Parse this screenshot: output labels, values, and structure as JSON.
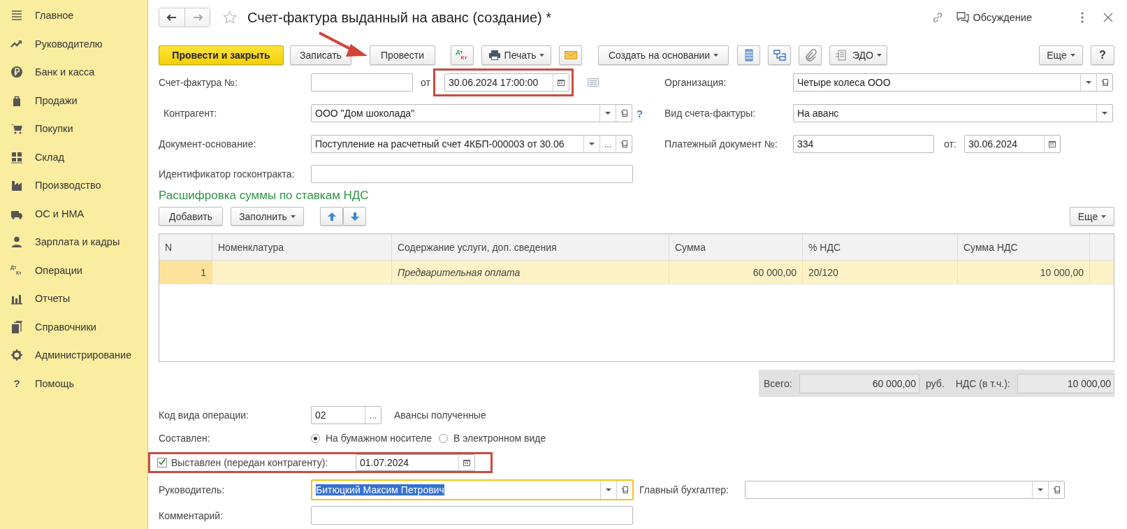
{
  "sidebar": {
    "items": [
      {
        "label": "Главное",
        "selected": false
      },
      {
        "label": "Руководителю",
        "selected": false
      },
      {
        "label": "Банк и касса",
        "selected": false
      },
      {
        "label": "Продажи",
        "selected": false
      },
      {
        "label": "Покупки",
        "selected": false
      },
      {
        "label": "Склад",
        "selected": false
      },
      {
        "label": "Производство",
        "selected": false
      },
      {
        "label": "ОС и НМА",
        "selected": false
      },
      {
        "label": "Зарплата и кадры",
        "selected": false
      },
      {
        "label": "Операции",
        "selected": false,
        "icon_text": [
          "Дт",
          "Кт"
        ]
      },
      {
        "label": "Отчеты",
        "selected": false
      },
      {
        "label": "Справочники",
        "selected": false
      },
      {
        "label": "Администрирование",
        "selected": false
      },
      {
        "label": "Помощь",
        "selected": false,
        "icon_text": [
          "?"
        ]
      }
    ]
  },
  "window": {
    "title": "Счет-фактура выданный на аванс (создание) *",
    "discussion": "Обсуждение"
  },
  "toolbar": {
    "post_and_close": "Провести и закрыть",
    "save": "Записать",
    "post": "Провести",
    "dt_kt": [
      "Дт",
      "Кт"
    ],
    "print": "Печать",
    "create_based_on": "Создать на основании",
    "edo": "ЭДО",
    "more": "Еще",
    "help": "?"
  },
  "form": {
    "invoice_number": {
      "label": "Счет-фактура №:"
    },
    "invoice_date": {
      "label": "от",
      "value": "30.06.2024 17:00:00",
      "highlighted": true
    },
    "organization": {
      "label": "Организация:",
      "value": "Четыре колеса ООО"
    },
    "counterparty": {
      "label": "Контрагент:",
      "value": "ООО \"Дом шоколада\"",
      "help": "?"
    },
    "invoice_type": {
      "label": "Вид счета-фактуры:",
      "value": "На аванс"
    },
    "base_document": {
      "label": "Документ-основание:",
      "value": "Поступление на расчетный счет 4КБП-000003 от 30.06",
      "more": "..."
    },
    "payment_document": {
      "label": "Платежный документ №:",
      "value": "334",
      "date_label": "от:",
      "date": "30.06.2024"
    },
    "contract_id": {
      "label": "Идентификатор госконтракта:"
    }
  },
  "vat_section": {
    "title": "Расшифровка суммы по ставкам НДС",
    "add": "Добавить",
    "fill": "Заполнить",
    "more": "Еще"
  },
  "table": {
    "columns": [
      "N",
      "Номенклатура",
      "Содержание услуги, доп. сведения",
      "Сумма",
      "% НДС",
      "Сумма НДС"
    ],
    "rows": [
      {
        "n": "1",
        "content": "Предварительная оплата",
        "sum": "60 000,00",
        "vat_rate": "20/120",
        "vat_sum": "10 000,00",
        "selected": true
      }
    ]
  },
  "totals": {
    "total_label": "Всего:",
    "total": "60 000,00",
    "currency": "руб.",
    "vat_label": "НДС (в т.ч.):",
    "vat": "10 000,00"
  },
  "details": {
    "operation_code": {
      "label": "Код вида операции:",
      "value": "02",
      "more": "...",
      "description": "Авансы полученные"
    },
    "composed": {
      "label": "Составлен:",
      "options": [
        {
          "label": "На бумажном носителе",
          "selected": true
        },
        {
          "label": "В электронном виде",
          "selected": false
        }
      ]
    },
    "issued": {
      "label": "Выставлен (передан контрагенту):",
      "checked": true,
      "date": "01.07.2024",
      "highlighted": true
    },
    "manager": {
      "label": "Руководитель:",
      "value": "Битюцкий Максим Петрович",
      "focused": true
    },
    "chief_accountant": {
      "label": "Главный бухгалтер:"
    },
    "comment": {
      "label": "Комментарий:"
    }
  }
}
